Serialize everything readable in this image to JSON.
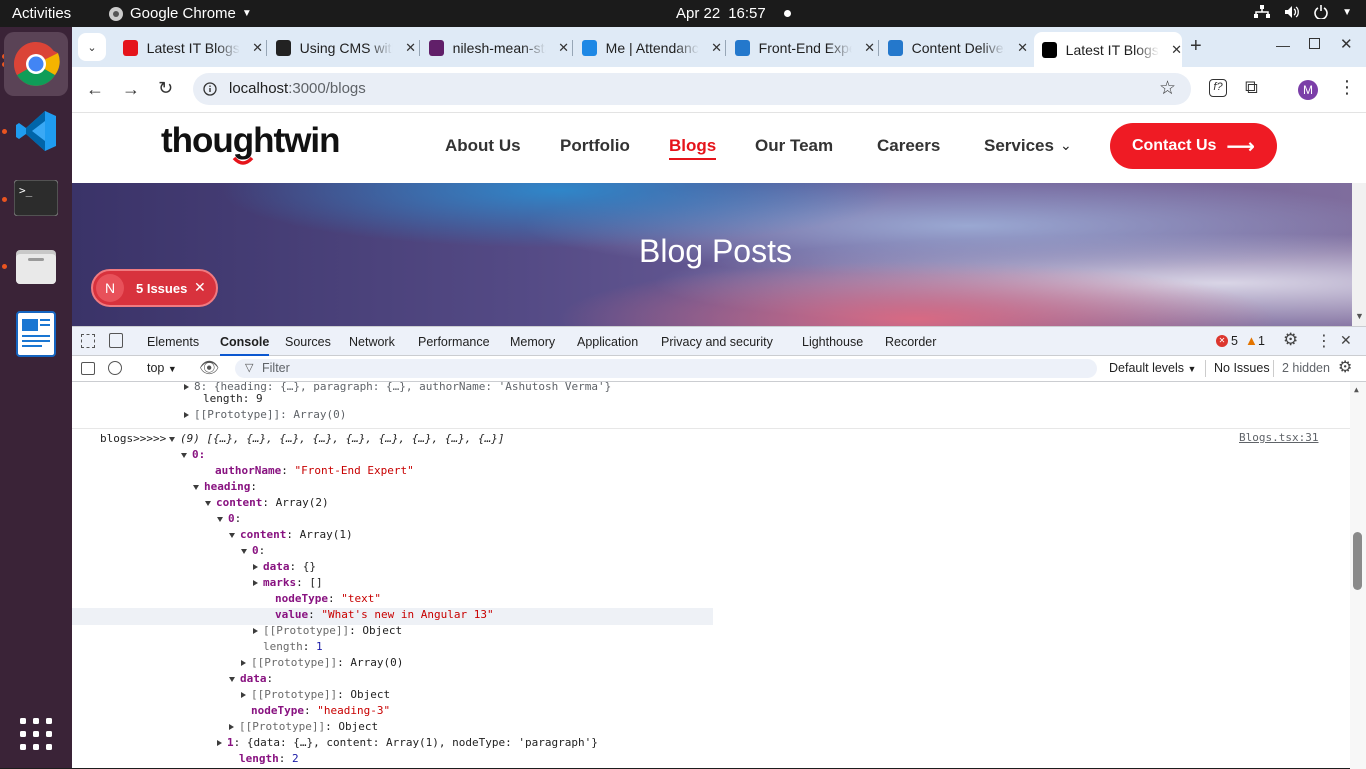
{
  "system": {
    "activities": "Activities",
    "app_name": "Google Chrome",
    "date": "Apr 22",
    "time": "16:57"
  },
  "dock": {
    "apps": [
      "chrome-icon",
      "vscode-icon",
      "terminal-icon",
      "files-icon",
      "writer-icon",
      "app-grid-icon"
    ]
  },
  "tabs": [
    {
      "title": "Latest IT Blogs",
      "icon": "thoughtwin-favicon",
      "color": "#e5141b"
    },
    {
      "title": "Using CMS with",
      "icon": "openai-favicon",
      "color": "#222222"
    },
    {
      "title": "nilesh-mean-stack",
      "icon": "slack-favicon",
      "color": "#611f69"
    },
    {
      "title": "Me | Attendance",
      "icon": "k-favicon",
      "color": "#1e88e5"
    },
    {
      "title": "Front-End Expert",
      "icon": "contentful-favicon",
      "color": "#2478cc"
    },
    {
      "title": "Content Delivery",
      "icon": "contentful-favicon",
      "color": "#2478cc"
    },
    {
      "title": "Latest IT Blogs",
      "icon": "nextjs-favicon",
      "color": "#000000",
      "active": true
    }
  ],
  "omnibox": {
    "host": "localhost",
    "path": ":3000/blogs",
    "profile_letter": "M"
  },
  "site": {
    "logo": "thoughtwin",
    "nav": [
      "About Us",
      "Portfolio",
      "Blogs",
      "Our Team",
      "Careers",
      "Services"
    ],
    "active_nav": "Blogs",
    "contact_label": "Contact Us",
    "hero_title": "Blog Posts",
    "issues_badge": "5 Issues",
    "issues_letter": "N"
  },
  "devtools": {
    "tabs": [
      "Elements",
      "Console",
      "Sources",
      "Network",
      "Performance",
      "Memory",
      "Application",
      "Privacy and security",
      "Lighthouse",
      "Recorder"
    ],
    "active_tab": "Console",
    "errors": "5",
    "warnings": "1",
    "context": "top",
    "filter_placeholder": "Filter",
    "levels": "Default levels",
    "no_issues": "No Issues",
    "hidden": "2 hidden",
    "source_link": "Blogs.tsx:31"
  },
  "console_lines": [
    {
      "text": "8: {heading: {…}, paragraph: {…}, authorName: 'Ashutosh Verma'}"
    },
    {
      "text": "length: 9"
    },
    {
      "text": "[[Prototype]]: Array(0)"
    },
    {
      "text": "blogs>>>>>"
    },
    {
      "text": "(9) [{…}, {…}, {…}, {…}, {…}, {…}, {…}, {…}, {…}]"
    },
    {
      "text": "0:"
    },
    {
      "key": "authorName",
      "value": "\"Front-End Expert\""
    },
    {
      "key": "heading",
      "value": ""
    },
    {
      "key": "content",
      "value": "Array(2)"
    },
    {
      "key": "0",
      "value": ""
    },
    {
      "key": "content",
      "value": "Array(1)"
    },
    {
      "key": "0",
      "value": ""
    },
    {
      "key": "data",
      "value": "{}"
    },
    {
      "key": "marks",
      "value": "[]"
    },
    {
      "key": "nodeType",
      "value": "\"text\""
    },
    {
      "key": "value",
      "value": "\"What's new in Angular 13\""
    },
    {
      "key": "[[Prototype]]",
      "value": "Object"
    },
    {
      "key": "length",
      "value": "1"
    },
    {
      "key": "[[Prototype]]",
      "value": "Array(0)"
    },
    {
      "key": "data",
      "value": ""
    },
    {
      "key": "[[Prototype]]",
      "value": "Object"
    },
    {
      "key": "nodeType",
      "value": "\"heading-3\""
    },
    {
      "key": "[[Prototype]]",
      "value": "Object"
    },
    {
      "key": "1",
      "value": "{data: {…}, content: Array(1), nodeType: 'paragraph'}"
    },
    {
      "key": "length",
      "value": "2"
    }
  ]
}
